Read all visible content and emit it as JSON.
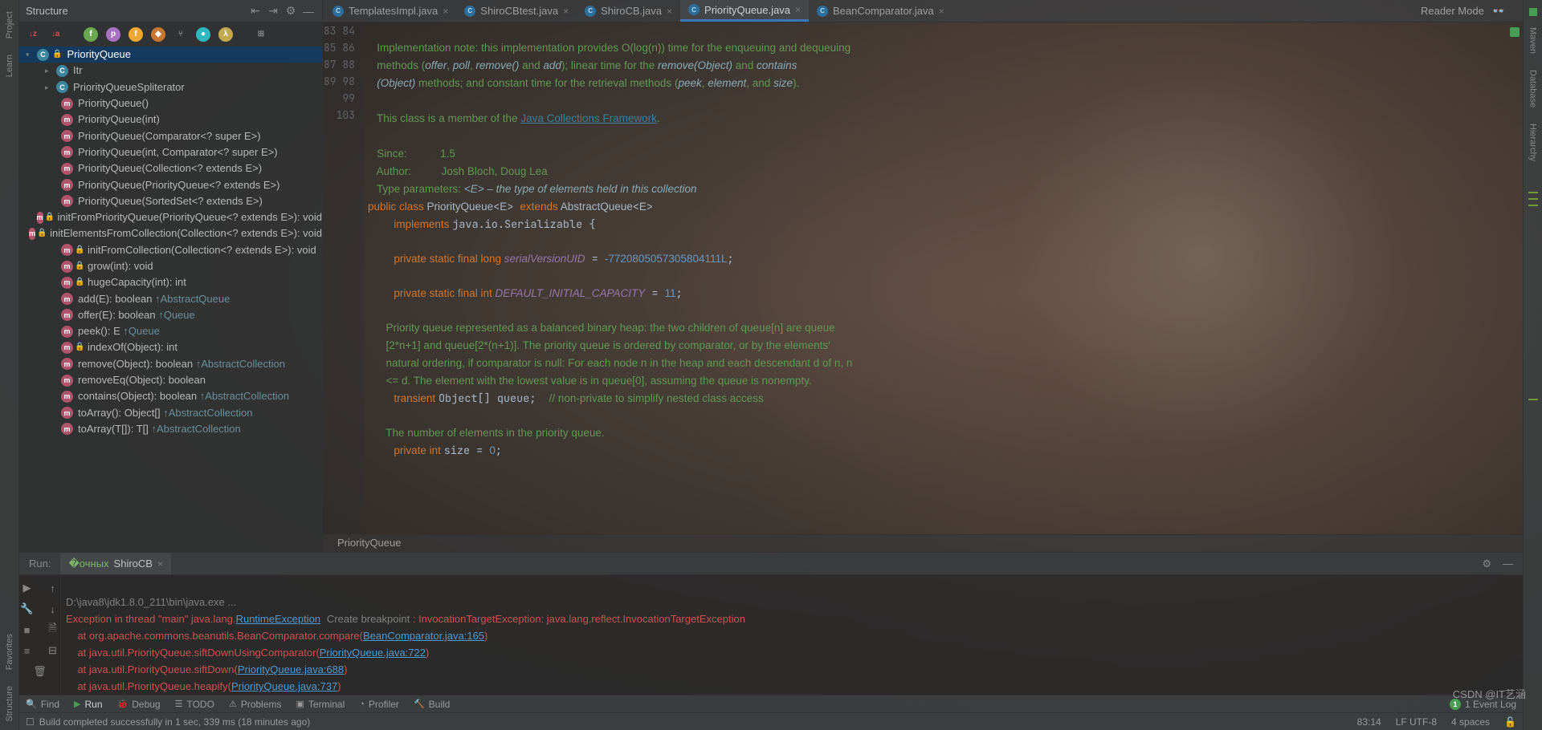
{
  "structure": {
    "title": "Structure",
    "root": "PriorityQueue",
    "items": [
      {
        "ind": 1,
        "arrow": "▸",
        "badge": "C",
        "lock": "",
        "text": "Itr"
      },
      {
        "ind": 1,
        "arrow": "▸",
        "badge": "C",
        "lock": "",
        "text": "PriorityQueueSpliterator"
      },
      {
        "ind": 2,
        "badge": "m",
        "lock": "",
        "text": "PriorityQueue()"
      },
      {
        "ind": 2,
        "badge": "m",
        "lock": "",
        "text": "PriorityQueue(int)"
      },
      {
        "ind": 2,
        "badge": "m",
        "lock": "",
        "text": "PriorityQueue(Comparator<? super E>)"
      },
      {
        "ind": 2,
        "badge": "m",
        "lock": "",
        "text": "PriorityQueue(int, Comparator<? super E>)"
      },
      {
        "ind": 2,
        "badge": "m",
        "lock": "",
        "text": "PriorityQueue(Collection<? extends E>)"
      },
      {
        "ind": 2,
        "badge": "m",
        "lock": "",
        "text": "PriorityQueue(PriorityQueue<? extends E>)"
      },
      {
        "ind": 2,
        "badge": "m",
        "lock": "",
        "text": "PriorityQueue(SortedSet<? extends E>)"
      },
      {
        "ind": 2,
        "badge": "m",
        "lock": "🔒",
        "text": "initFromPriorityQueue(PriorityQueue<? extends E>): void"
      },
      {
        "ind": 2,
        "badge": "m",
        "lock": "🔒",
        "text": "initElementsFromCollection(Collection<? extends E>): void"
      },
      {
        "ind": 2,
        "badge": "m",
        "lock": "🔒",
        "text": "initFromCollection(Collection<? extends E>): void"
      },
      {
        "ind": 2,
        "badge": "m",
        "lock": "🔒",
        "text": "grow(int): void"
      },
      {
        "ind": 2,
        "badge": "m",
        "lock": "🔒",
        "text": "hugeCapacity(int): int"
      },
      {
        "ind": 2,
        "badge": "m",
        "lock": "",
        "text": "add(E): boolean ↑AbstractQueue"
      },
      {
        "ind": 2,
        "badge": "m",
        "lock": "",
        "text": "offer(E): boolean ↑Queue"
      },
      {
        "ind": 2,
        "badge": "m",
        "lock": "",
        "text": "peek(): E ↑Queue"
      },
      {
        "ind": 2,
        "badge": "m",
        "lock": "🔒",
        "text": "indexOf(Object): int"
      },
      {
        "ind": 2,
        "badge": "m",
        "lock": "",
        "text": "remove(Object): boolean ↑AbstractCollection"
      },
      {
        "ind": 2,
        "badge": "m",
        "lock": "",
        "text": "removeEq(Object): boolean"
      },
      {
        "ind": 2,
        "badge": "m",
        "lock": "",
        "text": "contains(Object): boolean ↑AbstractCollection"
      },
      {
        "ind": 2,
        "badge": "m",
        "lock": "",
        "text": "toArray(): Object[] ↑AbstractCollection"
      },
      {
        "ind": 2,
        "badge": "m",
        "lock": "",
        "text": "toArray(T[]): T[] ↑AbstractCollection"
      }
    ]
  },
  "tabs": [
    {
      "name": "TemplatesImpl.java",
      "active": false
    },
    {
      "name": "ShiroCBtest.java",
      "active": false
    },
    {
      "name": "ShiroCB.java",
      "active": false
    },
    {
      "name": "PriorityQueue.java",
      "active": true
    },
    {
      "name": "BeanComparator.java",
      "active": false
    }
  ],
  "readerMode": "Reader Mode",
  "doc": {
    "l1": "Implementation note: this implementation provides O(log(n)) time for the enqueuing and dequeuing",
    "l2a": "methods (",
    "l2b": "offer",
    "l2c": ", ",
    "l2d": "poll",
    "l2e": ", ",
    "l2f": "remove()",
    "l2g": " and ",
    "l2h": "add",
    "l2i": "); linear time for the ",
    "l2j": "remove(Object)",
    "l2k": " and ",
    "l2l": "contains",
    "l3a": "(Object)",
    "l3b": " methods; and constant time for the retrieval methods (",
    "l3c": "peek",
    "l3d": ", ",
    "l3e": "element",
    "l3f": ", and ",
    "l3g": "size",
    "l3h": ").",
    "l4a": "This class is a member of the ",
    "l4b": "Java Collections Framework",
    "l4c": ".",
    "since_lbl": "Since:",
    "since_val": "1.5",
    "author_lbl": "Author:",
    "author_val": "Josh Bloch, Doug Lea",
    "tp_lbl": "Type parameters:",
    "tp_val": "<E> – the type of elements held in this collection"
  },
  "code": {
    "g": [
      "83",
      "84",
      "85",
      "86",
      "87",
      "88",
      "89",
      "",
      "",
      "",
      "",
      "98",
      "99",
      "",
      "103"
    ],
    "l83": "public class PriorityQueue<E> extends AbstractQueue<E>",
    "l84": "    implements java.io.Serializable {",
    "l86": "    private static final long serialVersionUID = -7720805057305804111L;",
    "l88": "    private static final int DEFAULT_INITIAL_CAPACITY = 11;",
    "d1": "Priority queue represented as a balanced binary heap: the two children of queue[n] are queue",
    "d2": "[2*n+1] and queue[2*(n+1)]. The priority queue is ordered by comparator, or by the elements'",
    "d3": "natural ordering, if comparator is null: For each node n in the heap and each descendant d of n, n",
    "d4": "<= d. The element with the lowest value is in queue[0], assuming the queue is nonempty.",
    "l98": "    transient Object[] queue;  // non-private to simplify nested class access",
    "d5": "The number of elements in the priority queue.",
    "l103": "    private int size = 0;"
  },
  "crumb": "PriorityQueue",
  "run": {
    "label": "Run:",
    "tab": "ShiroCB",
    "cmd": "D:\\java8\\jdk1.8.0_211\\bin\\java.exe ...",
    "e1a": "Exception in thread \"main\" java.lang.",
    "e1b": "RuntimeException",
    "e1c": "Create breakpoint",
    "e1d": " : InvocationTargetException: java.lang.reflect.InvocationTargetException",
    "s1a": "    at org.apache.commons.beanutils.BeanComparator.compare(",
    "s1b": "BeanComparator.java:165",
    "s1c": ")",
    "s2a": "    at java.util.PriorityQueue.siftDownUsingComparator(",
    "s2b": "PriorityQueue.java:722",
    "s2c": ")",
    "s3a": "    at java.util.PriorityQueue.siftDown(",
    "s3b": "PriorityQueue.java:688",
    "s3c": ")",
    "s4a": "    at java.util.PriorityQueue.heapify(",
    "s4b": "PriorityQueue.java:737",
    "s4c": ")"
  },
  "bottomTools": {
    "find": "Find",
    "run": "Run",
    "debug": "Debug",
    "todo": "TODO",
    "problems": "Problems",
    "terminal": "Terminal",
    "profiler": "Profiler",
    "build": "Build"
  },
  "status": {
    "msg": "Build completed successfully in 1 sec, 339 ms (18 minutes ago)",
    "pos": "83:14",
    "enc": "LF   UTF-8",
    "spaces": "4 spaces",
    "event": "1 Event Log"
  },
  "left": {
    "project": "Project",
    "learn": "Learn",
    "fav": "Favorites",
    "struct": "Structure"
  },
  "right": {
    "maven": "Maven",
    "db": "Database",
    "hier": "Hierarchy"
  },
  "watermark": "CSDN @IT艺涵"
}
